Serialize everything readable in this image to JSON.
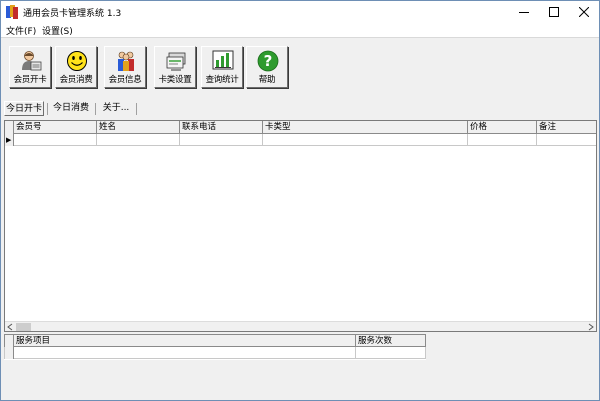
{
  "window": {
    "title": "通用会员卡管理系统 1.3",
    "controls": {
      "minimize": "minimize-icon",
      "maximize": "maximize-icon",
      "close": "close-icon"
    }
  },
  "menu": {
    "items": [
      {
        "label": "文件(F)"
      },
      {
        "label": "设置(S)"
      }
    ]
  },
  "toolbar": {
    "buttons": [
      {
        "label": "会员开卡",
        "icon": "member-card-icon"
      },
      {
        "label": "会员消费",
        "icon": "smiley-icon"
      },
      {
        "label": "会员信息",
        "icon": "people-icon"
      },
      {
        "label": "卡类设置",
        "icon": "card-settings-icon"
      },
      {
        "label": "查询统计",
        "icon": "bar-chart-icon"
      },
      {
        "label": "帮助",
        "icon": "help-icon"
      }
    ]
  },
  "tabs": [
    {
      "label": "今日开卡",
      "active": true
    },
    {
      "label": "今日消费",
      "active": false
    },
    {
      "label": "关于...",
      "active": false
    }
  ],
  "grid_main": {
    "columns": [
      "会员号",
      "姓名",
      "联系电话",
      "卡类型",
      "价格",
      "备注"
    ],
    "current_row_marker": "▶"
  },
  "grid_service": {
    "columns": [
      "服务项目",
      "服务次数"
    ]
  },
  "colors": {
    "accent_green": "#2e9b2e",
    "smiley_yellow": "#ffe21a",
    "window_border": "#6e8fb5"
  }
}
